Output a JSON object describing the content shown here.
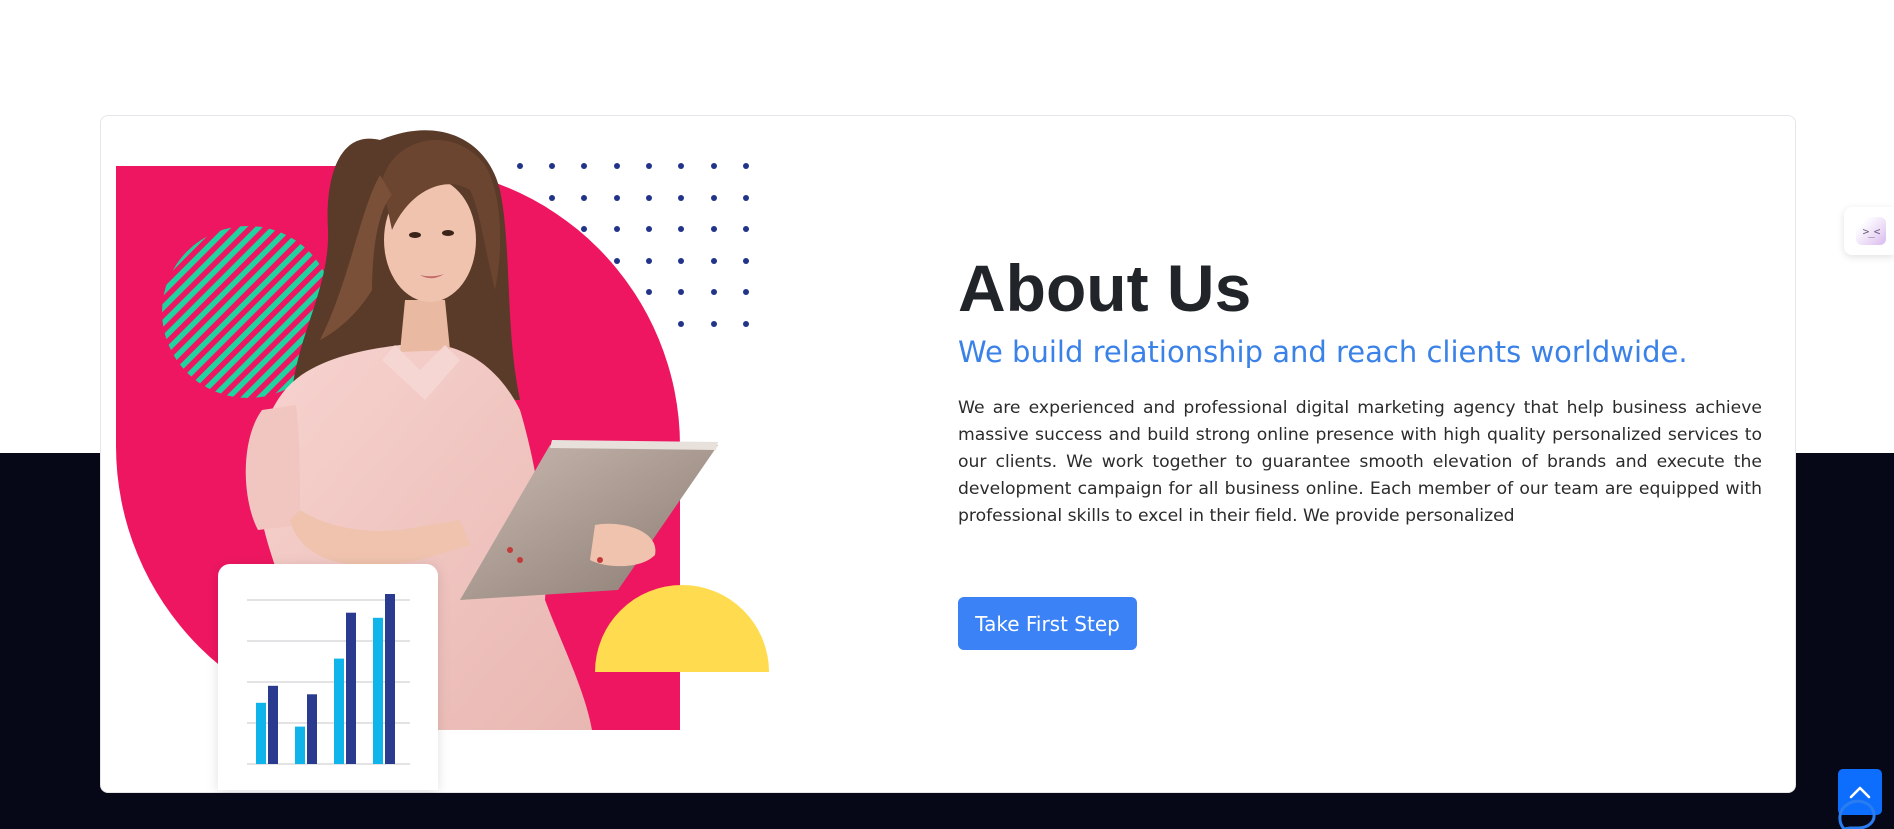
{
  "about": {
    "title": "About Us",
    "subtitle": "We build relationship and reach clients worldwide.",
    "body": "We are experienced and professional digital marketing agency that help business achieve massive success and build strong online presence with high quality personalized services to our clients. We work together to guarantee smooth elevation of brands and execute the development campaign for all business online. Each member of our team are equipped with professional skills to excel in their field. We provide personalized",
    "cta_label": "Take First Step"
  },
  "widgets": {
    "side_widget_glyph": ">_<",
    "scroll_top_icon": "chevron-up-icon",
    "chat_icon": "chat-bubble-icon"
  },
  "illustration": {
    "bar_chart_values": [
      [
        0.36,
        0.46
      ],
      [
        0.22,
        0.41
      ],
      [
        0.62,
        0.89
      ],
      [
        0.86,
        1.0
      ]
    ],
    "series_colors": [
      "#0fb5ea",
      "#2a3a8f"
    ]
  },
  "colors": {
    "accent": "#3b82f6",
    "subtitle": "#3b82e8",
    "pink_shape": "#ee1660",
    "mint_stripes": "#21d3a0",
    "yellow_shape": "#ffdb4f",
    "dots": "#22338a",
    "dark_band": "#060818"
  }
}
